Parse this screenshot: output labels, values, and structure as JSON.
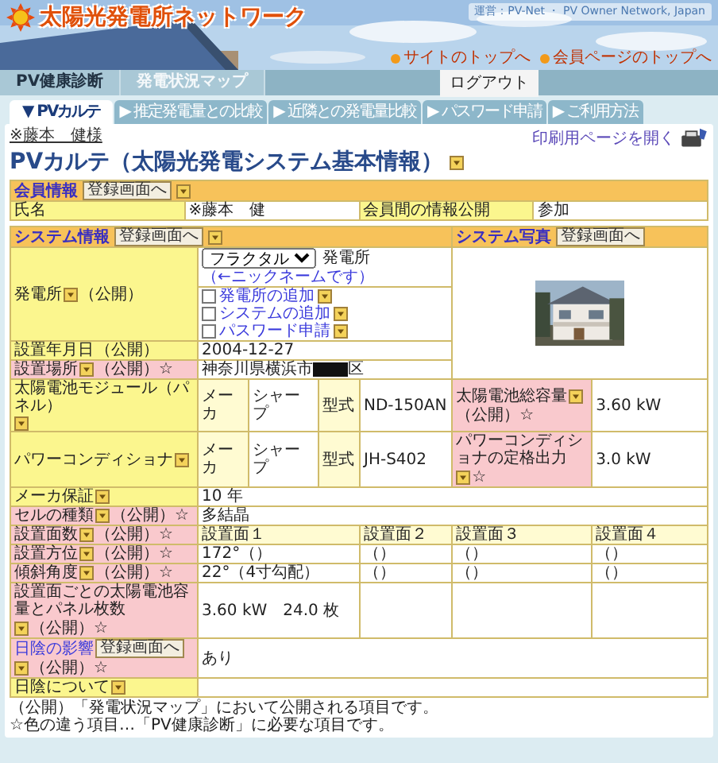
{
  "header": {
    "title": "太陽光発電所ネットワーク",
    "org": "運営：PV-Net ・ PV Owner Network, Japan",
    "links": [
      "サイトのトップへ",
      "会員ページのトップへ"
    ]
  },
  "nav": {
    "items": [
      "PV健康診断",
      "発電状況マップ"
    ],
    "logout": "ログアウト"
  },
  "tabs": [
    {
      "label": "▼ PVカルテ",
      "selected": true
    },
    {
      "label": "▶ 推定発電量との比較",
      "selected": false
    },
    {
      "label": "▶ 近隣との発電量比較",
      "selected": false
    },
    {
      "label": "▶ パスワード申請",
      "selected": false
    },
    {
      "label": "▶ ご利用方法",
      "selected": false
    }
  ],
  "user": "※藤本　健様",
  "print_link": "印刷用ページを開く",
  "page_title": "PVカルテ（太陽光発電システム基本情報）",
  "member": {
    "title": "会員情報",
    "button": "登録画面へ",
    "rows": [
      [
        {
          "kind": "label",
          "text": "氏名"
        },
        {
          "kind": "value",
          "text": "※藤本　健"
        },
        {
          "kind": "label",
          "text": "会員間の情報公開"
        },
        {
          "kind": "value",
          "text": "参加"
        }
      ]
    ]
  },
  "system": {
    "title": "システム情報",
    "button": "登録画面へ",
    "photo_title": "システム写真",
    "photo_button": "登録画面へ",
    "rows": [
      {
        "kind": "plant",
        "label": {
          "kind": "label",
          "text": "発電所",
          "help": true,
          "suffix": "（公開）"
        },
        "select": "フラクタル",
        "text": "発電所",
        "note": "（←ニックネームです）"
      },
      {
        "kind": "options",
        "items": [
          {
            "label": "発電所の追加",
            "checked": false
          },
          {
            "label": "システムの追加",
            "checked": false
          },
          {
            "label": "パスワード申請",
            "checked": false
          }
        ]
      },
      {
        "kind": "single",
        "label": {
          "kind": "label",
          "text": "設置年月日",
          "suffix": "（公開）"
        },
        "value": {
          "text": "2004-12-27"
        }
      },
      {
        "kind": "single",
        "label": {
          "kind": "req",
          "text": "設置場所",
          "help": true,
          "suffix": "（公開）☆"
        },
        "value": {
          "text": "神奈川県横浜市",
          "redacted": true,
          "after": "区"
        }
      },
      {
        "kind": "equipment",
        "label": {
          "kind": "label",
          "text": "太陽電池モジュール（パネル）",
          "help": true
        },
        "maker_label": "メーカ",
        "maker": "シャープ",
        "model_label": "型式",
        "model": "ND-150AN",
        "spec_label": {
          "kind": "req",
          "text": "太陽電池総容量",
          "help": true,
          "suffix": "（公開）☆"
        },
        "spec": "3.60 kW"
      },
      {
        "kind": "equipment",
        "label": {
          "kind": "label",
          "text": "パワーコンディショナ",
          "help": true
        },
        "maker_label": "メーカ",
        "maker": "シャープ",
        "model_label": "型式",
        "model": "JH-S402",
        "spec_label": {
          "kind": "req",
          "text": "パワーコンディショナの定格出力",
          "help": true,
          "suffix": "☆"
        },
        "spec": "3.0 kW"
      },
      {
        "kind": "single",
        "label": {
          "kind": "label",
          "text": "メーカ保証",
          "help": true
        },
        "value": {
          "text": "10 年"
        }
      },
      {
        "kind": "single",
        "label": {
          "kind": "req",
          "text": "セルの種類",
          "help": true,
          "suffix": "（公開）☆"
        },
        "value": {
          "text": "多結晶"
        }
      },
      {
        "kind": "planes",
        "label": {
          "kind": "req",
          "text": "設置面数",
          "help": true,
          "suffix": "（公開）☆"
        },
        "cells": [
          {
            "kind": "sub",
            "text": "設置面１"
          },
          {
            "kind": "sub",
            "text": "設置面２"
          },
          {
            "kind": "sub",
            "text": "設置面３"
          },
          {
            "kind": "sub",
            "text": "設置面４"
          }
        ]
      },
      {
        "kind": "planes",
        "label": {
          "kind": "req",
          "text": "設置方位",
          "help": true,
          "suffix": "（公開）☆"
        },
        "cells": [
          {
            "kind": "value",
            "text": "172°（）"
          },
          {
            "kind": "value",
            "text": "（）"
          },
          {
            "kind": "value",
            "text": "（）"
          },
          {
            "kind": "value",
            "text": "（）"
          }
        ]
      },
      {
        "kind": "planes",
        "label": {
          "kind": "req",
          "text": "傾斜角度",
          "help": true,
          "suffix": "（公開）☆"
        },
        "cells": [
          {
            "kind": "value",
            "text": "22°（4寸勾配）"
          },
          {
            "kind": "value",
            "text": "（）"
          },
          {
            "kind": "value",
            "text": "（）"
          },
          {
            "kind": "value",
            "text": "（）"
          }
        ]
      },
      {
        "kind": "planes",
        "label": {
          "kind": "req",
          "text": "設置面ごとの太陽電池容量とパネル枚数",
          "help": true,
          "suffix": "（公開）☆"
        },
        "cells": [
          {
            "kind": "value",
            "text": "3.60 kW　24.0 枚"
          },
          {
            "kind": "empty"
          },
          {
            "kind": "empty"
          },
          {
            "kind": "empty"
          }
        ]
      },
      {
        "kind": "single",
        "label": {
          "kind": "req",
          "text": "日陰の影響",
          "link": true,
          "button": "登録画面へ",
          "help": true,
          "suffix": "（公開）☆"
        },
        "value": {
          "text": "あり"
        }
      },
      {
        "kind": "single",
        "label": {
          "kind": "label",
          "text": "日陰について",
          "help": true
        }
      }
    ]
  },
  "notes": [
    "（公開）「発電状況マップ」において公開される項目です。",
    "☆色の違う項目…「PV健康診断」に必要な項目です。"
  ]
}
